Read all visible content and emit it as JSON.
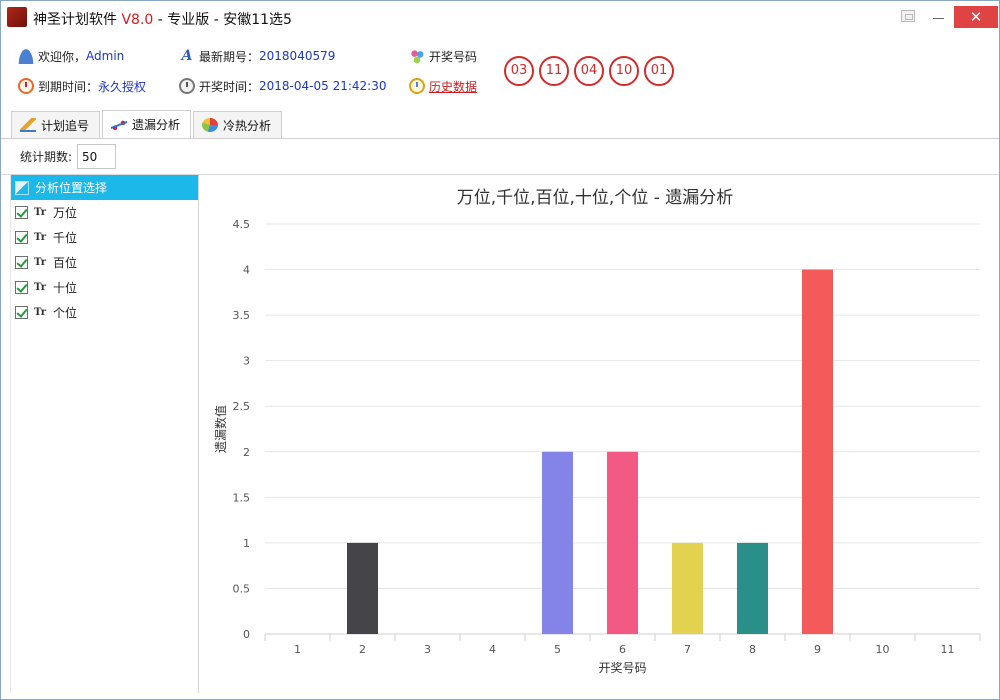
{
  "window": {
    "icon_text": "神圣",
    "title_prefix": "神圣计划软件 ",
    "title_version": "V8.0",
    "title_suffix": " - 专业版 - 安徽11选5",
    "close_label": "✕"
  },
  "info": {
    "welcome_label": "欢迎你，",
    "username": "Admin",
    "expiry_label": "到期时间：",
    "expiry_value": "永久授权",
    "latest_issue_label": "最新期号：",
    "latest_issue_value": "2018040579",
    "draw_time_label": "开奖时间：",
    "draw_time_value": "2018-04-05 21:42:30",
    "draw_numbers_label": "开奖号码",
    "history_link": "历史数据",
    "draw_numbers": [
      "03",
      "11",
      "04",
      "10",
      "01"
    ]
  },
  "tabs": [
    {
      "label": "计划追号",
      "icon": "pencil-icon"
    },
    {
      "label": "遗漏分析",
      "icon": "line-chart-icon"
    },
    {
      "label": "冷热分析",
      "icon": "pie-chart-icon"
    }
  ],
  "stats": {
    "label": "统计期数:",
    "value": "50"
  },
  "position_panel": {
    "header": "分析位置选择",
    "items": [
      {
        "label": "万位",
        "checked": true
      },
      {
        "label": "千位",
        "checked": true
      },
      {
        "label": "百位",
        "checked": true
      },
      {
        "label": "十位",
        "checked": true
      },
      {
        "label": "个位",
        "checked": true
      }
    ],
    "type_icon_text": "Tr"
  },
  "chart_data": {
    "type": "bar",
    "title": "万位,千位,百位,十位,个位 - 遗漏分析",
    "xlabel": "开奖号码",
    "ylabel": "遗漏数值",
    "categories": [
      "1",
      "2",
      "3",
      "4",
      "5",
      "6",
      "7",
      "8",
      "9",
      "10",
      "11"
    ],
    "values": [
      0,
      1,
      0,
      0,
      2,
      2,
      1,
      1,
      4,
      0,
      0
    ],
    "colors": [
      "#4a4a4a",
      "#454449",
      "#4a4a4a",
      "#4a4a4a",
      "#8484e8",
      "#f25a83",
      "#e3d250",
      "#2a8f88",
      "#f55a5a",
      "#4a4a4a",
      "#4a4a4a"
    ],
    "ylim": [
      0,
      4.5
    ],
    "yticks": [
      "0",
      "0.5",
      "1",
      "1.5",
      "2",
      "2.5",
      "3",
      "3.5",
      "4",
      "4.5"
    ],
    "grid": true
  }
}
